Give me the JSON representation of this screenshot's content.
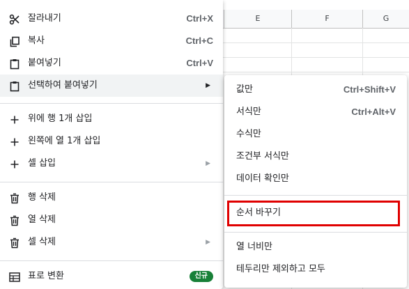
{
  "columns": [
    "E",
    "F",
    "G"
  ],
  "menu": {
    "items": [
      {
        "label": "잘라내기",
        "shortcut": "Ctrl+X",
        "icon": "scissors-icon"
      },
      {
        "label": "복사",
        "shortcut": "Ctrl+C",
        "icon": "copy-icon"
      },
      {
        "label": "붙여넣기",
        "shortcut": "Ctrl+V",
        "icon": "paste-icon"
      },
      {
        "label": "선택하여 붙여넣기",
        "arrow": "▶",
        "icon": "paste-special-icon"
      },
      {
        "label": "위에 행 1개 삽입",
        "icon": "plus-icon"
      },
      {
        "label": "왼쪽에 열 1개 삽입",
        "icon": "plus-icon"
      },
      {
        "label": "셀 삽입",
        "arrow": "▶",
        "icon": "plus-icon"
      },
      {
        "label": "행 삭제",
        "icon": "trash-icon"
      },
      {
        "label": "열 삭제",
        "icon": "trash-icon"
      },
      {
        "label": "셀 삭제",
        "arrow": "▶",
        "icon": "trash-icon"
      },
      {
        "label": "표로 변환",
        "badge": "신규",
        "icon": "table-icon"
      }
    ]
  },
  "submenu": {
    "items": [
      {
        "label": "값만",
        "shortcut": "Ctrl+Shift+V"
      },
      {
        "label": "서식만",
        "shortcut": "Ctrl+Alt+V"
      },
      {
        "label": "수식만"
      },
      {
        "label": "조건부 서식만"
      },
      {
        "label": "데이터 확인만"
      },
      {
        "label": "순서 바꾸기"
      },
      {
        "label": "열 너비만"
      },
      {
        "label": "테두리만 제외하고 모두"
      }
    ]
  },
  "colors": {
    "highlight_border": "#e00000",
    "badge_bg": "#188038"
  }
}
